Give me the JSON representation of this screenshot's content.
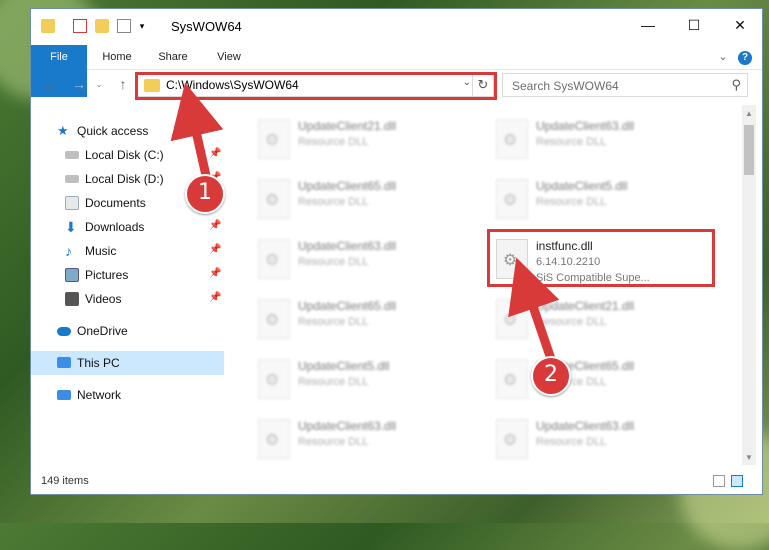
{
  "window": {
    "title": "SysWOW64",
    "controls": [
      "—",
      "☐",
      "✕"
    ]
  },
  "ribbon": {
    "tabs": [
      "File",
      "Home",
      "Share",
      "View"
    ]
  },
  "nav": {
    "address": "C:\\Windows\\SysWOW64",
    "search_placeholder": "Search SysWOW64"
  },
  "sidebar": {
    "items": [
      {
        "label": "Quick access",
        "icon": "star-icon"
      },
      {
        "label": "Local Disk (C:)",
        "icon": "drive-icon"
      },
      {
        "label": "Local Disk (D:)",
        "icon": "drive-icon"
      },
      {
        "label": "Documents",
        "icon": "documents-icon"
      },
      {
        "label": "Downloads",
        "icon": "download-icon"
      },
      {
        "label": "Music",
        "icon": "music-icon"
      },
      {
        "label": "Pictures",
        "icon": "pictures-icon"
      },
      {
        "label": "Videos",
        "icon": "videos-icon"
      },
      {
        "label": "OneDrive",
        "icon": "cloud-icon"
      },
      {
        "label": "This PC",
        "icon": "pc-icon"
      },
      {
        "label": "Network",
        "icon": "network-icon"
      }
    ]
  },
  "files": {
    "left": [
      {
        "name": "UpdateClient21.dll",
        "type": "Resource DLL"
      },
      {
        "name": "UpdateClient65.dll",
        "type": "Resource DLL"
      },
      {
        "name": "UpdateClient63.dll",
        "type": "Resource DLL"
      },
      {
        "name": "UpdateClient65.dll",
        "type": "Resource DLL"
      },
      {
        "name": "UpdateClient5.dll",
        "type": "Resource DLL"
      },
      {
        "name": "UpdateClient63.dll",
        "type": "Resource DLL"
      }
    ],
    "right": [
      {
        "name": "UpdateClient63.dll",
        "type": "Resource DLL"
      },
      {
        "name": "UpdateClient5.dll",
        "type": "Resource DLL"
      },
      {
        "name": "instfunc.dll",
        "type": "6.14.10.2210",
        "desc": "SiS Compatible Supe..."
      },
      {
        "name": "UpdateClient21.dll",
        "type": "Resource DLL"
      },
      {
        "name": "UpdateClient65.dll",
        "type": "Resource DLL"
      },
      {
        "name": "UpdateClient63.dll",
        "type": "Resource DLL"
      }
    ]
  },
  "status": {
    "count": "149 items"
  },
  "annotations": {
    "step1": "1",
    "step2": "2",
    "color": "#d83a3a"
  }
}
